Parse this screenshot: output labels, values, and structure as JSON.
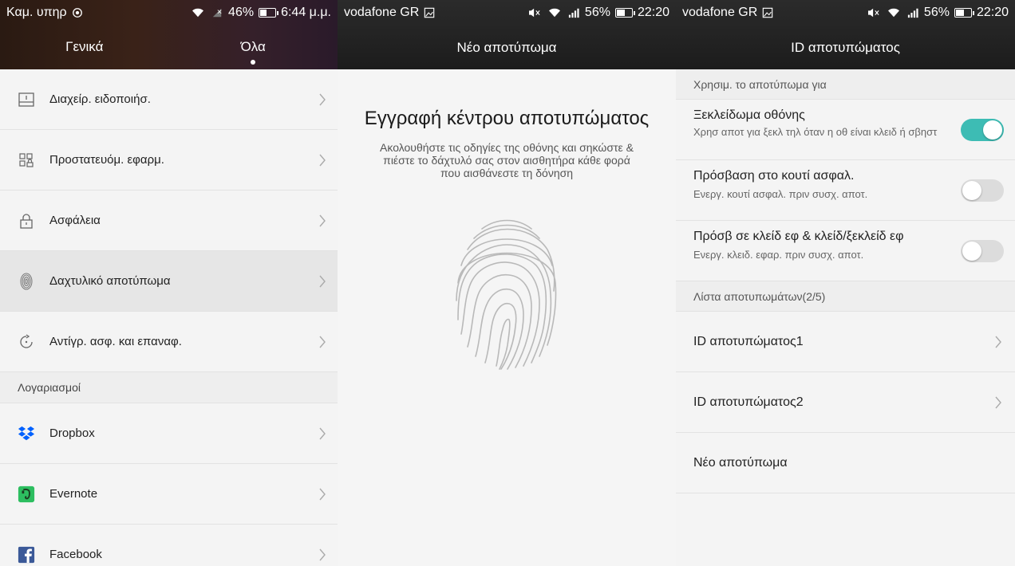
{
  "screen1": {
    "status": {
      "carrier": "Καμ. υπηρ",
      "battery": "46%",
      "battery_level": 0.46,
      "time": "6:44 μ.μ."
    },
    "tabs": [
      {
        "label": "Γενικά"
      },
      {
        "label": "Όλα"
      }
    ],
    "items": [
      {
        "label": "Διαχείρ. ειδοποιήσ.",
        "icon": "notification-panel-icon"
      },
      {
        "label": "Προστατευόμ. εφαρμ.",
        "icon": "protected-apps-icon"
      },
      {
        "label": "Ασφάλεια",
        "icon": "lock-icon"
      },
      {
        "label": "Δαχτυλικό αποτύπωμα",
        "icon": "fingerprint-icon"
      },
      {
        "label": "Αντίγρ. ασφ. και επαναφ.",
        "icon": "backup-restore-icon"
      }
    ],
    "accounts_header": "Λογαριασμοί",
    "accounts": [
      {
        "label": "Dropbox",
        "icon": "dropbox-icon",
        "color": "#0061fe"
      },
      {
        "label": "Evernote",
        "icon": "evernote-icon",
        "color": "#2dbe60"
      },
      {
        "label": "Facebook",
        "icon": "facebook-icon",
        "color": "#3b5998"
      }
    ]
  },
  "screen2": {
    "status": {
      "carrier": "vodafone GR",
      "battery": "56%",
      "battery_level": 0.56,
      "time": "22:20"
    },
    "title": "Νέο αποτύπωμα",
    "heading": "Εγγραφή κέντρου αποτυπώματος",
    "description": "Ακολουθήστε τις οδηγίες της οθόνης και σηκώστε & πιέστε το δάχτυλό σας στον αισθητήρα κάθε φορά που αισθάνεστε τη δόνηση"
  },
  "screen3": {
    "status": {
      "carrier": "vodafone GR",
      "battery": "56%",
      "battery_level": 0.56,
      "time": "22:20"
    },
    "title": "ID αποτυπώματος",
    "use_header": "Χρησιμ. το αποτύπωμα για",
    "options": [
      {
        "title": "Ξεκλείδωμα οθόνης",
        "subtitle": "Χρησ αποτ για ξεκλ τηλ όταν η οθ είναι κλειδ ή σβηστ",
        "enabled": true
      },
      {
        "title": "Πρόσβαση στο κουτί ασφαλ.",
        "subtitle": "Ενεργ. κουτί ασφαλ. πριν συσχ. αποτ.",
        "enabled": false
      },
      {
        "title": "Πρόσβ σε κλείδ εφ & κλείδ/ξεκλείδ εφ",
        "subtitle": "Ενεργ. κλειδ. εφαρ. πριν συσχ. αποτ.",
        "enabled": false
      }
    ],
    "list_header": "Λίστα αποτυπωμάτων(2/5)",
    "fingerprints": [
      {
        "label": "ID αποτυπώματος1"
      },
      {
        "label": "ID αποτυπώματος2"
      }
    ],
    "new_fingerprint": "Νέο αποτύπωμα",
    "accent": "#3dbcb4"
  }
}
